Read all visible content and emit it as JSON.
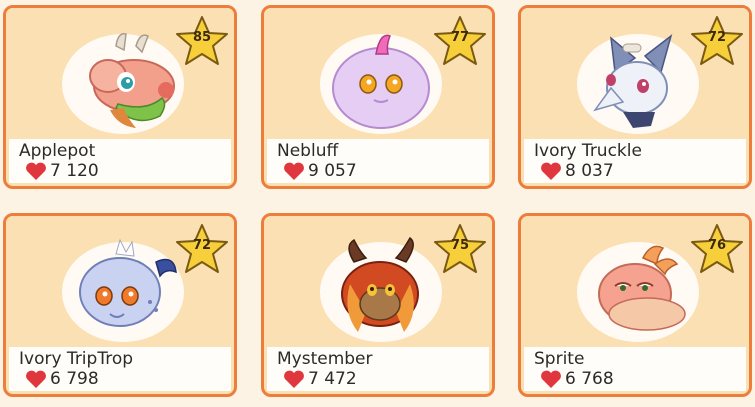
{
  "pets": [
    {
      "name": "Applepot",
      "likes": "7 120",
      "level": "85",
      "icon": "applepot-creature-icon"
    },
    {
      "name": "Nebluff",
      "likes": "9 057",
      "level": "77",
      "icon": "nebluff-creature-icon"
    },
    {
      "name": "Ivory Truckle",
      "likes": "8 037",
      "level": "72",
      "icon": "ivory-truckle-creature-icon"
    },
    {
      "name": "Ivory TripTrop",
      "likes": "6 798",
      "level": "72",
      "icon": "ivory-triptrop-creature-icon"
    },
    {
      "name": "Mystember",
      "likes": "7 472",
      "level": "75",
      "icon": "mystember-creature-icon"
    },
    {
      "name": "Sprite",
      "likes": "6 768",
      "level": "76",
      "icon": "sprite-creature-icon"
    }
  ],
  "colors": {
    "card_border": "#ec7d3a",
    "card_bg": "#fbe0b4",
    "star_fill": "#f6cf3a",
    "heart": "#e0373f"
  }
}
